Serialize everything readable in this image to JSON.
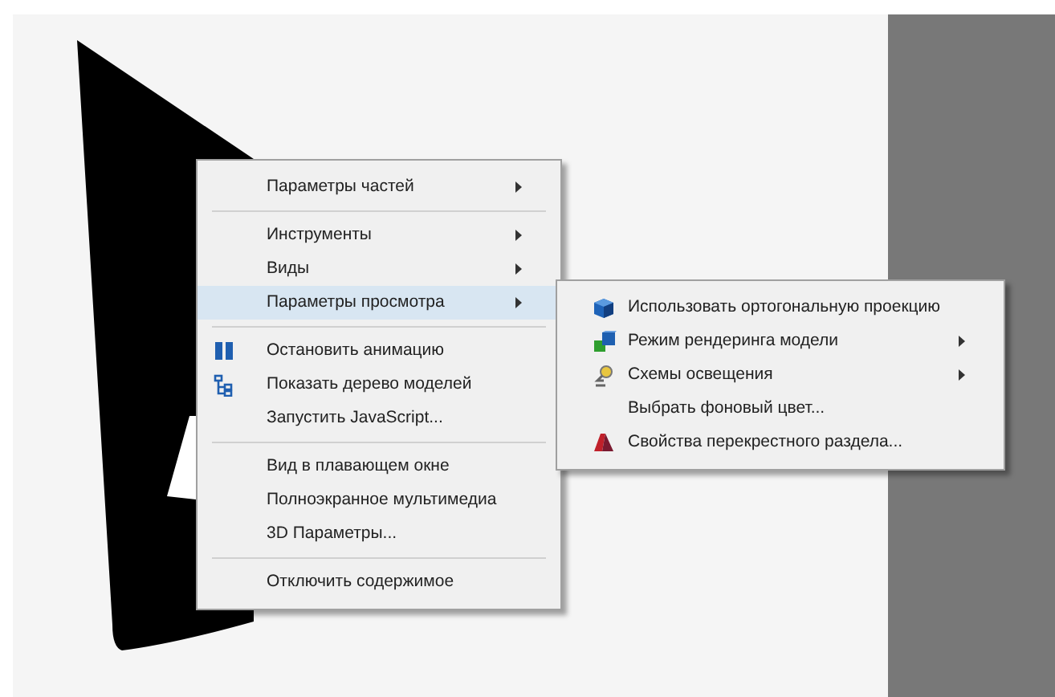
{
  "context_menu": {
    "items": [
      {
        "kind": "item",
        "label": "Параметры частей",
        "submenu": true,
        "selected": false
      },
      {
        "kind": "separator"
      },
      {
        "kind": "item",
        "label": "Инструменты",
        "submenu": true,
        "selected": false
      },
      {
        "kind": "item",
        "label": "Виды",
        "submenu": true,
        "selected": false
      },
      {
        "kind": "item",
        "label": "Параметры просмотра",
        "submenu": true,
        "selected": true
      },
      {
        "kind": "separator"
      },
      {
        "kind": "item",
        "label": "Остановить анимацию",
        "submenu": false,
        "selected": false
      },
      {
        "kind": "item",
        "label": "Показать дерево моделей",
        "submenu": false,
        "selected": false
      },
      {
        "kind": "item",
        "label": "Запустить JavaScript...",
        "submenu": false,
        "selected": false
      },
      {
        "kind": "separator"
      },
      {
        "kind": "item",
        "label": "Вид в плавающем окне",
        "submenu": false,
        "selected": false
      },
      {
        "kind": "item",
        "label": "Полноэкранное мультимедиа",
        "submenu": false,
        "selected": false
      },
      {
        "kind": "item",
        "label": "3D Параметры...",
        "submenu": false,
        "selected": false
      },
      {
        "kind": "separator"
      },
      {
        "kind": "item",
        "label": "Отключить содержимое",
        "submenu": false,
        "selected": false
      }
    ]
  },
  "submenu": {
    "items": [
      {
        "label": "Использовать ортогональную проекцию",
        "submenu": false
      },
      {
        "label": "Режим рендеринга модели",
        "submenu": true
      },
      {
        "label": "Схемы освещения",
        "submenu": true
      },
      {
        "label": "Выбрать фоновый цвет...",
        "submenu": false
      },
      {
        "label": "Свойства перекрестного раздела...",
        "submenu": false
      }
    ]
  }
}
